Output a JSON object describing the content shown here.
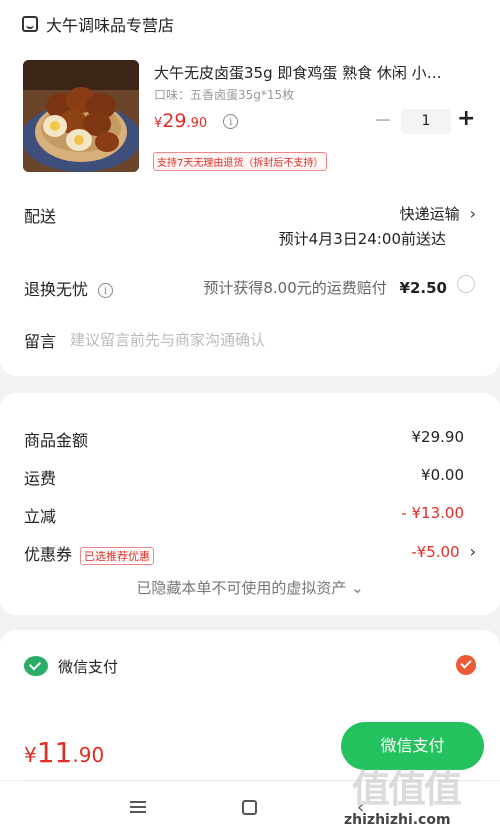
{
  "store": {
    "name": "大午调味品专营店",
    "icon": "store-icon"
  },
  "product": {
    "title": "大午无皮卤蛋35g 即食鸡蛋 熟食 休闲 小…",
    "spec": "口味：五香卤蛋35g*15枚",
    "price_currency": "¥",
    "price_int": "29",
    "price_dec": ".90",
    "info_glyph": "i",
    "quantity": "1",
    "minus": "−",
    "plus": "+",
    "return_tag": "支持7天无理由退货（拆封后不支持）"
  },
  "delivery": {
    "label": "配送",
    "method": "快递运输",
    "estimate": "预计4月3日24:00前送达",
    "chevron": "›"
  },
  "worry_free": {
    "label": "退换无忧",
    "desc": "预计获得8.00元的运费赔付",
    "price": "¥2.50"
  },
  "message": {
    "label": "留言",
    "placeholder": "建议留言前先与商家沟通确认"
  },
  "summary": {
    "goods_label": "商品金额",
    "goods_value": "¥29.90",
    "shipping_label": "运费",
    "shipping_value": "¥0.00",
    "discount_label": "立减",
    "discount_value": "- ¥13.00",
    "coupon_label": "优惠券",
    "coupon_tag": "已选推荐优惠",
    "coupon_value": "-¥5.00",
    "hidden_note": "已隐藏本单不可使用的虚拟资产 ⌄"
  },
  "payment": {
    "method": "微信支付",
    "icon": "wechat-pay-icon"
  },
  "bottom": {
    "total_currency": "¥",
    "total_int": "11",
    "total_dec": ".90",
    "pay_button": "微信支付"
  },
  "watermark": {
    "glyphs": "值值值",
    "url": "zhizhizhi.com"
  },
  "colors": {
    "price_red": "#e02e24",
    "wechat_green": "#23c25f",
    "checked_orange": "#ec5a38"
  }
}
